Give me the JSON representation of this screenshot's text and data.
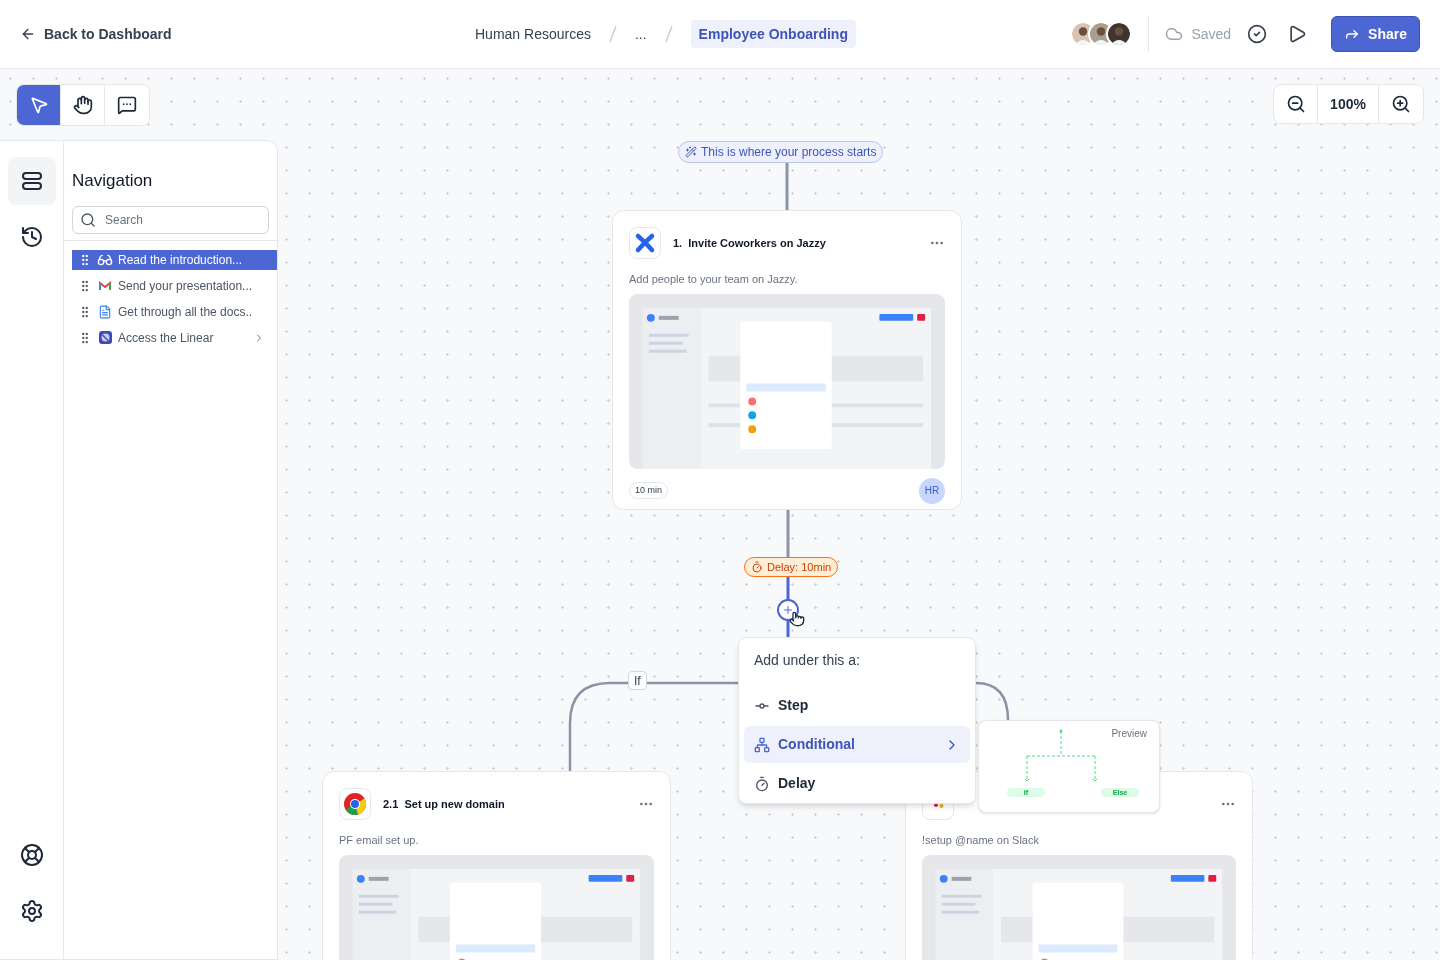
{
  "header": {
    "back_link": "Back to Dashboard",
    "breadcrumbs": [
      {
        "label": "Human Resources",
        "selected": false
      },
      {
        "label": "...",
        "selected": false
      },
      {
        "label": "Employee Onboarding",
        "selected": true
      }
    ],
    "collaborators": [
      {
        "kind": "avatar"
      },
      {
        "kind": "avatar"
      },
      {
        "kind": "avatar"
      }
    ],
    "save_status": "Saved",
    "share_button": "Share"
  },
  "tools": [
    {
      "kind": "select",
      "selected": true
    },
    {
      "kind": "hand",
      "selected": false
    },
    {
      "kind": "comment",
      "selected": false
    }
  ],
  "zoom": {
    "value": "100%"
  },
  "sidebar": {
    "rail": [
      {
        "kind": "outline",
        "selected": true
      },
      {
        "kind": "history",
        "selected": false
      }
    ],
    "rail_bottom": [
      {
        "kind": "help"
      },
      {
        "kind": "settings"
      }
    ],
    "title": "Navigation",
    "search": {
      "placeholder": "Search"
    },
    "items": [
      {
        "label": "Read the introduction...",
        "kind": "glasses",
        "selected": true,
        "expandable": false
      },
      {
        "label": "Send your presentation...",
        "kind": "gmail",
        "selected": false,
        "expandable": false
      },
      {
        "label": "Get through all the docs..",
        "kind": "doc",
        "selected": false,
        "expandable": false
      },
      {
        "label": "Access the Linear",
        "kind": "linear",
        "selected": false,
        "expandable": true
      }
    ]
  },
  "flow": {
    "start_label": "This is where your process starts",
    "steps": [
      {
        "kind": "jazzy",
        "number": "1.",
        "title": "Invite Coworkers on Jazzy",
        "description": "Add people to your team on Jazzy.",
        "duration": "10 min",
        "assignee": "HR"
      },
      {
        "kind": "chrome",
        "number": "2.1",
        "title": "Set up new domain",
        "description": "PF email set up."
      },
      {
        "kind": "slack",
        "description": "!setup @name on Slack"
      }
    ],
    "delay": "Delay: 10min",
    "branch_label": "If",
    "add_menu": {
      "title": "Add under this a:",
      "options": [
        {
          "kind": "step",
          "label": "Step",
          "selected": false
        },
        {
          "kind": "conditional",
          "label": "Conditional",
          "selected": true
        },
        {
          "kind": "delay",
          "label": "Delay",
          "selected": false
        }
      ]
    },
    "preview": {
      "title": "Preview",
      "branches": [
        "If",
        "Else"
      ]
    }
  }
}
